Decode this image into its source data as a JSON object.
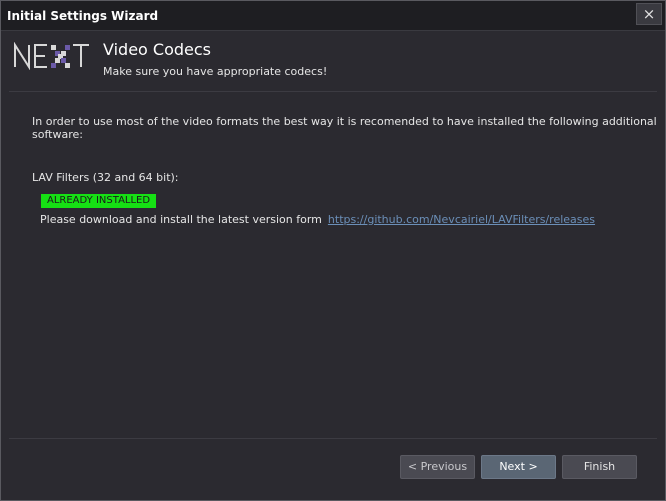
{
  "window": {
    "title": "Initial Settings Wizard",
    "close_glyph": "×"
  },
  "header": {
    "logo_icon": "next-logo-icon",
    "title": "Video Codecs",
    "subtitle": "Make sure you have appropriate codecs!"
  },
  "content": {
    "intro": "In order to use most of the video formats the best way it is recomended to have installed the following additional software:",
    "lav": {
      "title": "LAV Filters (32 and 64 bit):",
      "status": "ALREADY INSTALLED",
      "download_text": "Please download and install the latest version form",
      "download_link": "https://github.com/Nevcairiel/LAVFilters/releases"
    }
  },
  "buttons": {
    "previous": "< Previous",
    "next": "Next >",
    "finish": "Finish"
  },
  "colors": {
    "background": "#2b2a30",
    "badge": "#16e014",
    "link": "#6b8fb8",
    "logo_accent": "#6b5aa8"
  }
}
